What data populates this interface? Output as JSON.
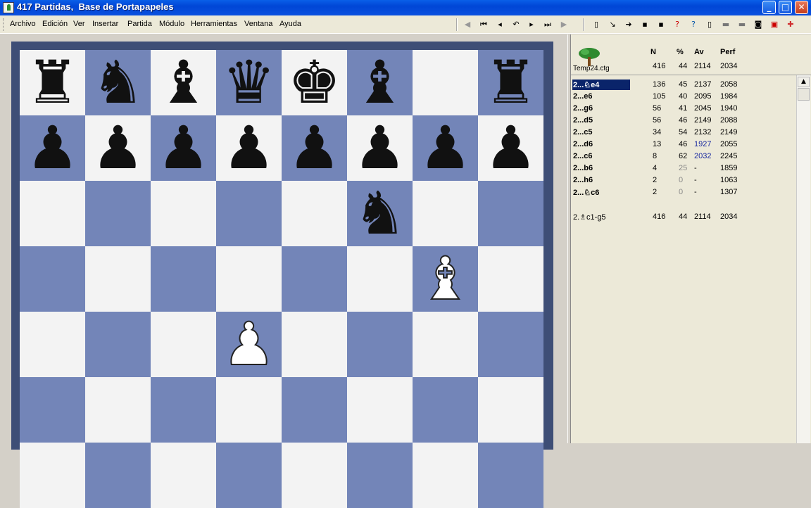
{
  "window": {
    "title": "417 Partidas,  Base de Portapapeles",
    "minimize": "_",
    "maximize": "□",
    "close": "✕"
  },
  "menu": [
    {
      "label": "Archivo"
    },
    {
      "label": "Edición"
    },
    {
      "label": "Ver"
    },
    {
      "label": "Insertar"
    },
    {
      "label": "Partida"
    },
    {
      "label": "Módulo"
    },
    {
      "label": "Herramientas"
    },
    {
      "label": "Ventana"
    },
    {
      "label": "Ayuda"
    }
  ],
  "toolbar": {
    "nav_icons": [
      "back-circle-icon",
      "first-move-icon",
      "prev-move-icon",
      "takeback-icon",
      "next-move-icon",
      "last-move-icon",
      "forward-circle-icon"
    ],
    "nav_glyphs": [
      "◀",
      "⏮",
      "◂",
      "↶",
      "▸",
      "⏭",
      "▶"
    ],
    "action_icons": [
      "new-document-icon",
      "arrow-in-icon",
      "arrow-out-icon",
      "save-icon",
      "save-all-icon",
      "help-check-icon",
      "properties-icon",
      "copy-icon",
      "eraser-icon",
      "eraser-alt-icon",
      "camera-icon",
      "pdf-icon",
      "cross-icon"
    ],
    "action_glyphs": [
      "▯",
      "↘",
      "➜",
      "▪",
      "▪",
      "?",
      "?",
      "▯",
      "▬",
      "▬",
      "◙",
      "▣",
      "✚"
    ]
  },
  "board": {
    "ranks": [
      [
        "br",
        "bn",
        "bb",
        "bq",
        "bk",
        "bb",
        "",
        "br"
      ],
      [
        "bp",
        "bp",
        "bp",
        "bp",
        "bp",
        "bp",
        "bp",
        "bp"
      ],
      [
        "",
        "",
        "",
        "",
        "",
        "bn",
        "",
        ""
      ],
      [
        "",
        "",
        "",
        "",
        "",
        "",
        "wb",
        ""
      ],
      [
        "",
        "",
        "",
        "wp",
        "",
        "",
        "",
        ""
      ],
      [
        "",
        "",
        "",
        "",
        "",
        "",
        "",
        ""
      ]
    ],
    "glyphs": {
      "br": "♜",
      "bn": "♞",
      "bb": "♝",
      "bq": "♛",
      "bk": "♚",
      "bp": "♟",
      "wb": "♝",
      "wp": "♟"
    },
    "colors": {
      "light": "#f3f3f3",
      "dark": "#7385b8",
      "frame": "#3e4e76"
    }
  },
  "stats": {
    "book_name": "Temp24.ctg",
    "headers": {
      "n": "N",
      "pct": "%",
      "av": "Av",
      "perf": "Perf"
    },
    "totals": {
      "n": "416",
      "pct": "44",
      "av": "2114",
      "perf": "2034"
    },
    "moves": [
      {
        "move": "2...♘e4",
        "n": "136",
        "pct": "45",
        "av": "2137",
        "perf": "2058",
        "selected": true
      },
      {
        "move": "2...e6",
        "n": "105",
        "pct": "40",
        "av": "2095",
        "perf": "1984"
      },
      {
        "move": "2...g6",
        "n": "56",
        "pct": "41",
        "av": "2045",
        "perf": "1940"
      },
      {
        "move": "2...d5",
        "n": "56",
        "pct": "46",
        "av": "2149",
        "perf": "2088"
      },
      {
        "move": "2...c5",
        "n": "34",
        "pct": "54",
        "av": "2132",
        "perf": "2149"
      },
      {
        "move": "2...d6",
        "n": "13",
        "pct": "46",
        "av": "1927",
        "perf": "2055",
        "av_blue": true
      },
      {
        "move": "2...c6",
        "n": "8",
        "pct": "62",
        "av": "2032",
        "perf": "2245",
        "av_blue": true
      },
      {
        "move": "2...b6",
        "n": "4",
        "pct": "25",
        "av": "-",
        "perf": "1859",
        "pct_grey": true
      },
      {
        "move": "2...h6",
        "n": "2",
        "pct": "0",
        "av": "-",
        "perf": "1063",
        "pct_grey": true
      },
      {
        "move": "2...♘c6",
        "n": "2",
        "pct": "0",
        "av": "-",
        "perf": "1307",
        "pct_grey": true
      }
    ],
    "played": {
      "move": "2.♗c1-g5",
      "n": "416",
      "pct": "44",
      "av": "2114",
      "perf": "2034"
    }
  }
}
